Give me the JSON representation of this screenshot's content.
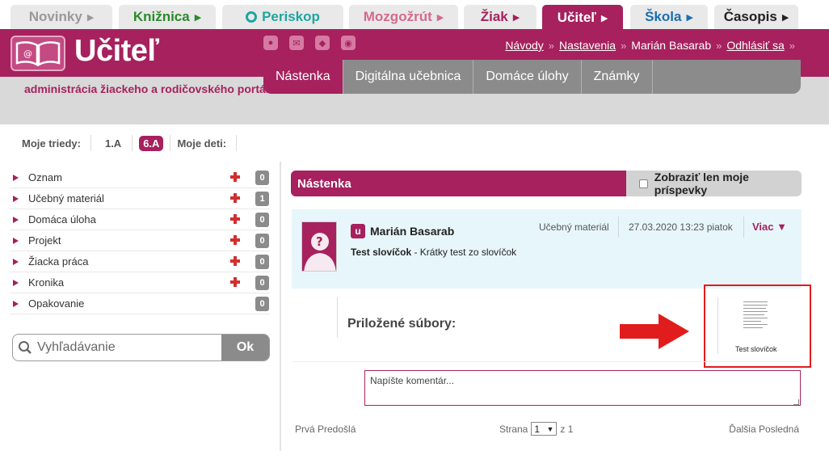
{
  "top_tabs": [
    {
      "label": "Novinky",
      "color": "#999999",
      "arrow": "▶"
    },
    {
      "label": "Knižnica",
      "color": "#2a8a2a",
      "arrow": "▶"
    },
    {
      "label": "Periskop",
      "color": "#1ea6a0",
      "arrow": ""
    },
    {
      "label": "Mozgožrút",
      "color": "#d46a8a",
      "arrow": "▶"
    },
    {
      "label": "Žiak",
      "color": "#a6215e",
      "arrow": "▶"
    },
    {
      "label": "Učiteľ",
      "color": "#ffffff",
      "arrow": "▶"
    },
    {
      "label": "Škola",
      "color": "#1a6fb0",
      "arrow": "▶"
    },
    {
      "label": "Časopis",
      "color": "#222222",
      "arrow": "▶"
    }
  ],
  "header": {
    "logo_text": "Učiteľ",
    "subtitle": "administrácia žiackeho a rodičovského portálu",
    "user_links": {
      "navody": "Návody",
      "nastavenia": "Nastavenia",
      "user": "Marián Basarab",
      "logout": "Odhlásiť sa",
      "sep": "»"
    }
  },
  "main_nav": [
    "Nástenka",
    "Digitálna učebnica",
    "Domáce úlohy",
    "Známky"
  ],
  "class_row": {
    "label_classes": "Moje triedy:",
    "classes": [
      "1.A",
      "6.A"
    ],
    "label_children": "Moje deti:"
  },
  "left_nav": [
    {
      "label": "Oznam",
      "count": "0",
      "plus": true
    },
    {
      "label": "Učebný materiál",
      "count": "1",
      "plus": true
    },
    {
      "label": "Domáca úloha",
      "count": "0",
      "plus": true
    },
    {
      "label": "Projekt",
      "count": "0",
      "plus": true
    },
    {
      "label": "Žiacka práca",
      "count": "0",
      "plus": true
    },
    {
      "label": "Kronika",
      "count": "0",
      "plus": true
    },
    {
      "label": "Opakovanie",
      "count": "0",
      "plus": false
    }
  ],
  "search": {
    "placeholder": "Vyhľadávanie",
    "button": "Ok"
  },
  "board": {
    "title": "Nástenka",
    "filter_label": "Zobraziť len moje príspevky"
  },
  "post": {
    "badge": "u",
    "author": "Marián Basarab",
    "type": "Učebný materiál",
    "date": "27.03.2020 13:23 piatok",
    "more": "Viac",
    "more_icon": "▼",
    "title": "Test slovíčok",
    "description": " - Krátky test zo slovíčok"
  },
  "attachments": {
    "label": "Priložené súbory:",
    "file_name": "Test slovíčok"
  },
  "comment": {
    "placeholder": "Napíšte komentár..."
  },
  "pager": {
    "left": "Prvá Predošlá",
    "page_label": "Strana",
    "page_value": "1",
    "of_label": "z 1",
    "right": "Ďalšia Posledná"
  },
  "colors": {
    "brand": "#a6215e",
    "gray": "#8b8b8b",
    "highlight": "#e11c1c"
  }
}
